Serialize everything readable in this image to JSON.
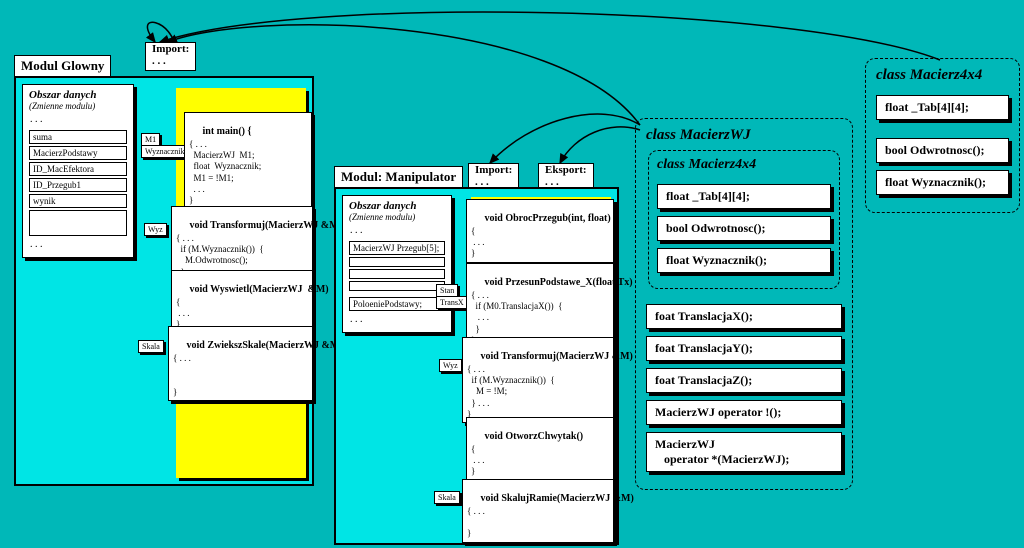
{
  "module1": {
    "title": "Modul Glowny",
    "import": "Import:\n. . .",
    "dataArea": {
      "heading": "Obszar danych",
      "sub": "(Zmienne modulu)",
      "dots": ". . .",
      "vars": [
        "suma",
        "MacierzPodstawy",
        "ID_MacEfektora",
        "ID_Przegub1",
        "wynik"
      ],
      "trailing": ". . ."
    },
    "funcs": {
      "main": {
        "sig": "int main() {",
        "body": "{ . . .\n  MacierzWJ  M1;\n  float  Wyznacznik;\n  M1 = !M1;\n  . . .\n}",
        "params": [
          "M1",
          "Wyznacznik"
        ]
      },
      "transformuj": {
        "sig": "void Transformuj(MacierzWJ &M)",
        "body": "{ . . .\n  if (M.Wyznacznik())  {\n    M.Odwrotnosc();\n  }\n}",
        "params": [
          "Wyz"
        ]
      },
      "wyswietl": {
        "sig": "void Wyswietl(MacierzWJ  &M)",
        "body": "{\n . . .\n}"
      },
      "zwieksz": {
        "sig": "void ZwiekszSkale(MacierzWJ &M)",
        "body": "{ . . .\n\n\n}",
        "params": [
          "Skala"
        ]
      }
    }
  },
  "module2": {
    "title": "Modul: Manipulator",
    "import": "Import:\n. . .",
    "export": "Eksport:\n. . .",
    "dataArea": {
      "heading": "Obszar danych",
      "sub": "(Zmienne modulu)",
      "dots": ". . .",
      "vars": [
        "MacierzWJ Przegub[5];",
        "",
        "",
        ""
      ],
      "below": "PoloeniePodstawy;",
      "trailing": ". . ."
    },
    "funcs": {
      "obroc": {
        "sig": "void ObrocPrzegub(int, float)",
        "body": "{\n . . .\n}"
      },
      "przesun": {
        "sig": "void PrzesunPodstawe_X(float Tx)",
        "body": "{ . . .\n  if (M0.TranslacjaX())  {\n   . . .\n  }\n}",
        "params": [
          "Stan",
          "TransX"
        ]
      },
      "transformuj": {
        "sig": "void Transformuj(MacierzWJ &M)",
        "body": "{ . . .\n  if (M.Wyznacznik())  {\n    M = !M;\n  } . . .\n}",
        "params": [
          "Wyz"
        ]
      },
      "otworz": {
        "sig": "void OtworzChwytak()",
        "body": "{\n . . .\n}"
      },
      "skaluj": {
        "sig": "void SkalujRamie(MacierzWJ &M)",
        "body": "{ . . .\n\n}",
        "params": [
          "Skala"
        ]
      }
    }
  },
  "class1": {
    "title": "class MacierzWJ",
    "inner": {
      "title": "class Macierz4x4",
      "members": [
        "float _Tab[4][4];",
        "bool Odwrotnosc();",
        "float Wyznacznik();"
      ]
    },
    "members": [
      "foat TranslacjaX();",
      "foat TranslacjaY();",
      "foat TranslacjaZ();",
      "MacierzWJ operator !();",
      "MacierzWJ\n   operator *(MacierzWJ);"
    ]
  },
  "class2": {
    "title": "class Macierz4x4",
    "members": [
      "float _Tab[4][4];",
      "bool Odwrotnosc();",
      "float Wyznacznik();"
    ]
  }
}
